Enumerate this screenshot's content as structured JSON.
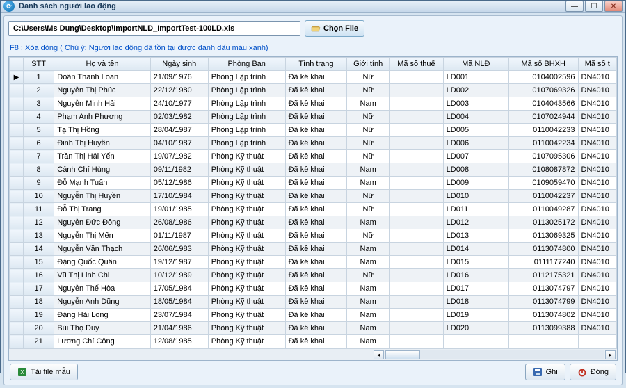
{
  "window": {
    "title": "Danh sách người lao động"
  },
  "file": {
    "path": "C:\\Users\\Ms Dung\\Desktop\\ImportNLD_ImportTest-100LD.xls",
    "choose_label": "Chọn File"
  },
  "hint": "F8 : Xóa dòng ( Chú ý: Người lao động đã tồn tại được đánh dấu màu xanh)",
  "columns": {
    "stt": "STT",
    "name": "Họ và tên",
    "dob": "Ngày sinh",
    "dept": "Phòng Ban",
    "status": "Tình trạng",
    "gender": "Giới tính",
    "tax": "Mã số thuế",
    "nld": "Mã NLĐ",
    "bhxh": "Mã số BHXH",
    "taxid": "Mã số t"
  },
  "rows": [
    {
      "stt": "1",
      "name": "Doãn Thanh Loan",
      "dob": "21/09/1976",
      "dept": "Phòng Lập trình",
      "status": "Đã kê khai",
      "gender": "Nữ",
      "tax": "",
      "nld": "LD001",
      "bhxh": "0104002596",
      "taxid": "DN4010"
    },
    {
      "stt": "2",
      "name": "Nguyễn Thị Phúc",
      "dob": "22/12/1980",
      "dept": "Phòng Lập trình",
      "status": "Đã kê khai",
      "gender": "Nữ",
      "tax": "",
      "nld": "LD002",
      "bhxh": "0107069326",
      "taxid": "DN4010"
    },
    {
      "stt": "3",
      "name": "Nguyễn Minh Hải",
      "dob": "24/10/1977",
      "dept": "Phòng Lập trình",
      "status": "Đã kê khai",
      "gender": "Nam",
      "tax": "",
      "nld": "LD003",
      "bhxh": "0104043566",
      "taxid": "DN4010"
    },
    {
      "stt": "4",
      "name": "Phạm Anh Phương",
      "dob": "02/03/1982",
      "dept": "Phòng Lập trình",
      "status": "Đã kê khai",
      "gender": "Nữ",
      "tax": "",
      "nld": "LD004",
      "bhxh": "0107024944",
      "taxid": "DN4010"
    },
    {
      "stt": "5",
      "name": "Tạ Thị Hồng",
      "dob": "28/04/1987",
      "dept": "Phòng Lập trình",
      "status": "Đã kê khai",
      "gender": "Nữ",
      "tax": "",
      "nld": "LD005",
      "bhxh": "0110042233",
      "taxid": "DN4010"
    },
    {
      "stt": "6",
      "name": "Đinh Thị Huyền",
      "dob": "04/10/1987",
      "dept": "Phòng Lập trình",
      "status": "Đã kê khai",
      "gender": "Nữ",
      "tax": "",
      "nld": "LD006",
      "bhxh": "0110042234",
      "taxid": "DN4010"
    },
    {
      "stt": "7",
      "name": "Trần Thị Hải Yến",
      "dob": "19/07/1982",
      "dept": "Phòng Kỹ thuật",
      "status": "Đã kê khai",
      "gender": "Nữ",
      "tax": "",
      "nld": "LD007",
      "bhxh": "0107095306",
      "taxid": "DN4010"
    },
    {
      "stt": "8",
      "name": "Cảnh Chí Hùng",
      "dob": "09/11/1982",
      "dept": "Phòng Kỹ thuật",
      "status": "Đã kê khai",
      "gender": "Nam",
      "tax": "",
      "nld": "LD008",
      "bhxh": "0108087872",
      "taxid": "DN4010"
    },
    {
      "stt": "9",
      "name": "Đỗ Mạnh Tuấn",
      "dob": "05/12/1986",
      "dept": "Phòng Kỹ thuật",
      "status": "Đã kê khai",
      "gender": "Nam",
      "tax": "",
      "nld": "LD009",
      "bhxh": "0109059470",
      "taxid": "DN4010"
    },
    {
      "stt": "10",
      "name": "Nguyễn Thị Huyền",
      "dob": "17/10/1984",
      "dept": "Phòng Kỹ thuật",
      "status": "Đã kê khai",
      "gender": "Nữ",
      "tax": "",
      "nld": "LD010",
      "bhxh": "0110042237",
      "taxid": "DN4010"
    },
    {
      "stt": "11",
      "name": "Đỗ Thị Trang",
      "dob": "19/01/1985",
      "dept": "Phòng Kỹ thuật",
      "status": "Đã kê khai",
      "gender": "Nữ",
      "tax": "",
      "nld": "LD011",
      "bhxh": "0110049287",
      "taxid": "DN4010"
    },
    {
      "stt": "12",
      "name": "Nguyễn Đức Đông",
      "dob": "26/08/1986",
      "dept": "Phòng Kỹ thuật",
      "status": "Đã kê khai",
      "gender": "Nam",
      "tax": "",
      "nld": "LD012",
      "bhxh": "0113025172",
      "taxid": "DN4010"
    },
    {
      "stt": "13",
      "name": "Nguyễn Thị Mến",
      "dob": "01/11/1987",
      "dept": "Phòng Kỹ thuật",
      "status": "Đã kê khai",
      "gender": "Nữ",
      "tax": "",
      "nld": "LD013",
      "bhxh": "0113069325",
      "taxid": "DN4010"
    },
    {
      "stt": "14",
      "name": "Nguyễn Văn Thạch",
      "dob": "26/06/1983",
      "dept": "Phòng Kỹ thuật",
      "status": "Đã kê khai",
      "gender": "Nam",
      "tax": "",
      "nld": "LD014",
      "bhxh": "0113074800",
      "taxid": "DN4010"
    },
    {
      "stt": "15",
      "name": "Đặng Quốc Quân",
      "dob": "19/12/1987",
      "dept": "Phòng Kỹ thuật",
      "status": "Đã kê khai",
      "gender": "Nam",
      "tax": "",
      "nld": "LD015",
      "bhxh": "0111177240",
      "taxid": "DN4010"
    },
    {
      "stt": "16",
      "name": "Vũ Thị Linh Chi",
      "dob": "10/12/1989",
      "dept": "Phòng Kỹ thuật",
      "status": "Đã kê khai",
      "gender": "Nữ",
      "tax": "",
      "nld": "LD016",
      "bhxh": "0112175321",
      "taxid": "DN4010"
    },
    {
      "stt": "17",
      "name": "Nguyễn Thế Hòa",
      "dob": "17/05/1984",
      "dept": "Phòng Kỹ thuật",
      "status": "Đã kê khai",
      "gender": "Nam",
      "tax": "",
      "nld": "LD017",
      "bhxh": "0113074797",
      "taxid": "DN4010"
    },
    {
      "stt": "18",
      "name": "Nguyễn Anh Dũng",
      "dob": "18/05/1984",
      "dept": "Phòng Kỹ thuật",
      "status": "Đã kê khai",
      "gender": "Nam",
      "tax": "",
      "nld": "LD018",
      "bhxh": "0113074799",
      "taxid": "DN4010"
    },
    {
      "stt": "19",
      "name": "Đặng Hải Long",
      "dob": "23/07/1984",
      "dept": "Phòng Kỹ thuật",
      "status": "Đã kê khai",
      "gender": "Nam",
      "tax": "",
      "nld": "LD019",
      "bhxh": "0113074802",
      "taxid": "DN4010"
    },
    {
      "stt": "20",
      "name": "Bùi Thọ Duy",
      "dob": "21/04/1986",
      "dept": "Phòng Kỹ thuật",
      "status": "Đã kê khai",
      "gender": "Nam",
      "tax": "",
      "nld": "LD020",
      "bhxh": "0113099388",
      "taxid": "DN4010"
    },
    {
      "stt": "21",
      "name": "Lương Chí Công",
      "dob": "12/08/1985",
      "dept": "Phòng Kỹ thuật",
      "status": "Đã kê khai",
      "gender": "Nam",
      "tax": "",
      "nld": "",
      "bhxh": "",
      "taxid": ""
    }
  ],
  "footer": {
    "download": "Tải file mẫu",
    "save": "Ghi",
    "close": "Đóng"
  }
}
